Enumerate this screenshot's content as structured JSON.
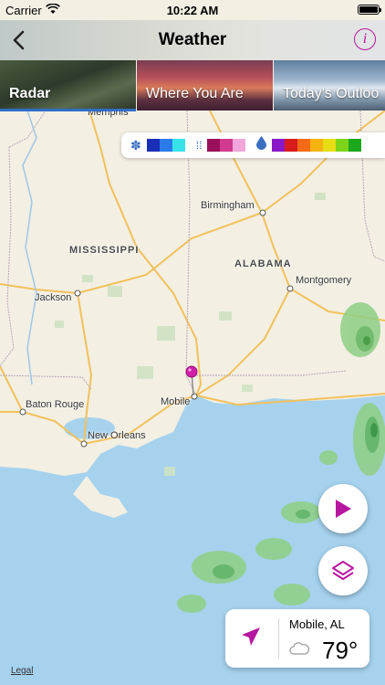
{
  "status_bar": {
    "carrier": "Carrier",
    "time": "10:22 AM"
  },
  "nav": {
    "title": "Weather",
    "info_label": "i"
  },
  "tabs": [
    {
      "label": "Radar",
      "selected": true
    },
    {
      "label": "Where You Are",
      "selected": false
    },
    {
      "label": "Today's Outloo",
      "selected": false
    }
  ],
  "legend": {
    "snow_icon": "snowflake-icon",
    "snow_colors": [
      "#1a2fb8",
      "#2a7bea",
      "#37e3ea"
    ],
    "mix_icon": "sleet-icon",
    "mix_colors": [
      "#9a0f5b",
      "#d13a8f",
      "#f3a6dc"
    ],
    "rain_icon": "raindrop-icon",
    "rain_colors": [
      "#8a18c9",
      "#d81b1b",
      "#f56a16",
      "#f5b30f",
      "#e6dd12",
      "#7bd41a",
      "#1ca81c"
    ]
  },
  "map": {
    "states": [
      "MISSISSIPPI",
      "ALABAMA"
    ],
    "cities": [
      "Memphis",
      "Birmingham",
      "Jackson",
      "Montgomery",
      "Baton Rouge",
      "Mobile",
      "New Orleans"
    ],
    "legal_label": "Legal"
  },
  "location_card": {
    "city": "Mobile, AL",
    "temperature": "79°"
  },
  "colors": {
    "accent": "#b6179f",
    "tab_underline": "#2f6ec9",
    "water": "#a6d2ee",
    "land": "#f3efe3"
  }
}
